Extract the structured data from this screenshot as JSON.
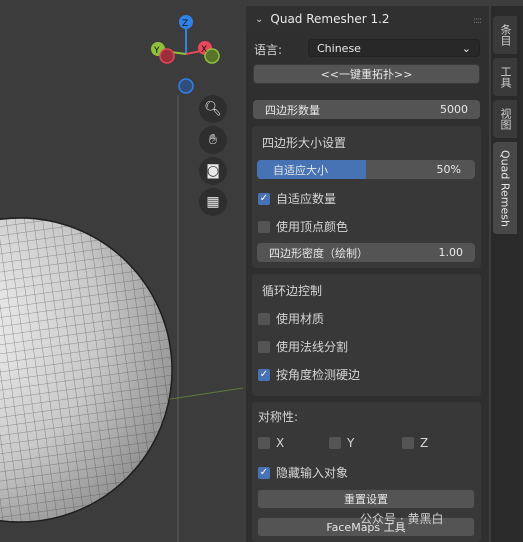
{
  "viewport": {
    "gizmo": {
      "z_label": "Z",
      "y_label": "Y",
      "x_label": "X"
    },
    "nav_icons": [
      "zoom-icon",
      "hand-icon",
      "camera-icon",
      "grid-icon"
    ]
  },
  "panel": {
    "title": "Quad Remesher 1.2",
    "language_label": "语言:",
    "language_value": "Chinese",
    "remesh_button": "<<一键重拓扑>>",
    "quad_count_label": "四边形数量",
    "quad_count_value": "5000",
    "size_section": {
      "title": "四边形大小设置",
      "adaptive_size_label": "自适应大小",
      "adaptive_size_value": "50%",
      "adaptive_size_fraction": 0.5,
      "adaptive_count_label": "自适应数量",
      "adaptive_count_checked": true,
      "vertex_color_label": "使用顶点颜色",
      "vertex_color_checked": false,
      "density_label": "四边形密度（绘制）",
      "density_value": "1.00"
    },
    "loop_section": {
      "title": "循环边控制",
      "use_material_label": "使用材质",
      "use_material_checked": false,
      "use_normals_label": "使用法线分割",
      "use_normals_checked": false,
      "angle_label": "按角度检测硬边",
      "angle_checked": true
    },
    "symmetry_section": {
      "title": "对称性:",
      "x_label": "X",
      "y_label": "Y",
      "z_label": "Z",
      "hide_input_label": "隐藏输入对象",
      "hide_input_checked": true,
      "reset_button": "重置设置",
      "facemaps_button": "FaceMaps 工具"
    }
  },
  "tabs": [
    "条目",
    "工具",
    "视图",
    "Quad Remesh"
  ],
  "watermark": "公众号 · 黄黑白",
  "colors": {
    "accent": "#4772b3",
    "panel_bg": "#2f2f2f",
    "box_bg": "#383838"
  }
}
